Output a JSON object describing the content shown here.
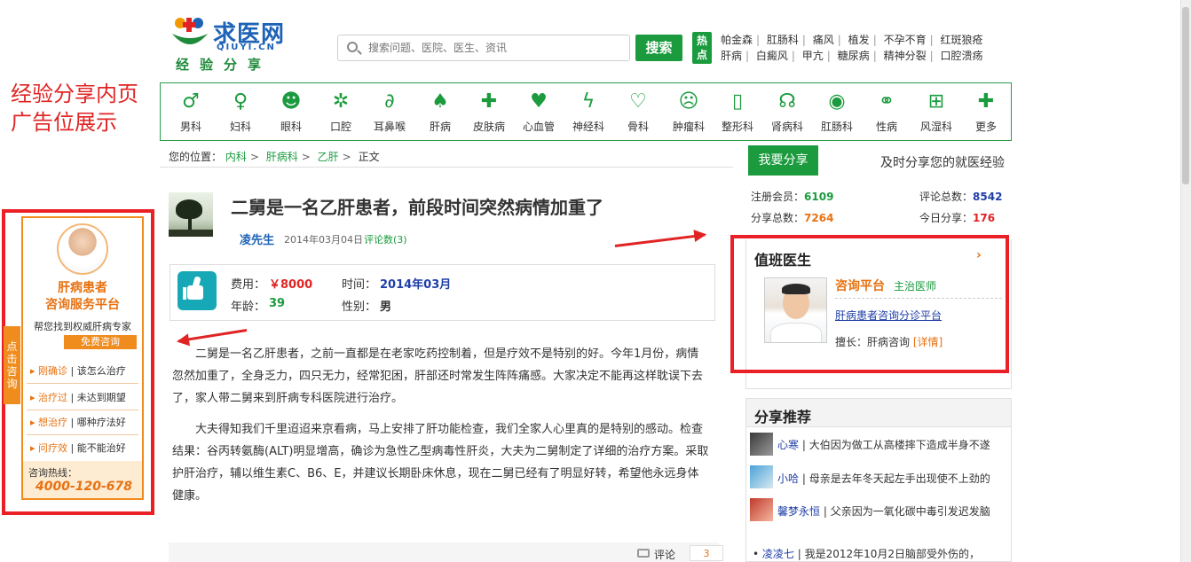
{
  "logo": {
    "name": "求医网",
    "en": "QIUYI.CN",
    "sub": "经验分享"
  },
  "search": {
    "placeholder": "搜索问题、医院、医生、资讯",
    "button": "搜索"
  },
  "hot": {
    "tag": "热点",
    "row1": [
      "帕金森",
      "肛肠科",
      "痛风",
      "植发",
      "不孕不育",
      "红斑狼疮"
    ],
    "row2": [
      "肝病",
      "白癜风",
      "甲亢",
      "糖尿病",
      "精神分裂",
      "口腔溃疡"
    ]
  },
  "annotation": {
    "line1": "经验分享内页",
    "line2": "广告位展示"
  },
  "nav": [
    {
      "label": "男科",
      "icon": "male-icon"
    },
    {
      "label": "妇科",
      "icon": "female-icon"
    },
    {
      "label": "眼科",
      "icon": "eye-head-icon"
    },
    {
      "label": "口腔",
      "icon": "tooth-icon"
    },
    {
      "label": "耳鼻喉",
      "icon": "ear-icon"
    },
    {
      "label": "肝病",
      "icon": "liver-icon"
    },
    {
      "label": "皮肤病",
      "icon": "ambulance-icon"
    },
    {
      "label": "心血管",
      "icon": "heart-organ-icon"
    },
    {
      "label": "神经科",
      "icon": "nerve-icon"
    },
    {
      "label": "骨科",
      "icon": "bone-icon"
    },
    {
      "label": "肿瘤科",
      "icon": "tumor-icon"
    },
    {
      "label": "整形科",
      "icon": "bottle-icon"
    },
    {
      "label": "肾病科",
      "icon": "stethoscope-icon"
    },
    {
      "label": "肛肠科",
      "icon": "eye-icon"
    },
    {
      "label": "性病",
      "icon": "couple-icon"
    },
    {
      "label": "风湿科",
      "icon": "first-aid-icon"
    },
    {
      "label": "更多",
      "icon": "plus-icon"
    }
  ],
  "breadcrumb": {
    "prefix": "您的位置：",
    "l1": "内科",
    "l2": "肝病科",
    "l3": "乙肝",
    "current": "正文"
  },
  "article": {
    "title": "二舅是一名乙肝患者，前段时间突然病情加重了",
    "author": "凌先生",
    "date": "2014年03月04日",
    "comments": "评论数(3)",
    "fee_label": "费用：",
    "fee_value": "￥8000",
    "time_label": "时间：",
    "time_value": "2014年03月",
    "age_label": "年龄：",
    "age_value": "39",
    "gender_label": "性别：",
    "gender_value": "男",
    "p1": "二舅是一名乙肝患者，之前一直都是在老家吃药控制着，但是疗效不是特别的好。今年1月份，病情忽然加重了，全身乏力，四只无力，经常犯困，肝部还时常发生阵阵痛感。大家决定不能再这样耽误下去了，家人带二舅来到肝病专科医院进行治疗。",
    "p2": "大夫得知我们千里迢迢来京看病，马上安排了肝功能检查，我们全家人心里真的是特别的感动。检查结果：谷丙转氨酶(ALT)明显增高，确诊为急性乙型病毒性肝炎，大夫为二舅制定了详细的治疗方案。采取护肝治疗，辅以维生素C、B6、E，并建议长期卧床休息，现在二舅已经有了明显好转，希望他永远身体健康。"
  },
  "bottom": {
    "comment_label": "评论",
    "comment_count": "3"
  },
  "ad": {
    "title1": "肝病患者",
    "title2": "咨询服务平台",
    "sub": "帮您找到权威肝病专家",
    "free": "免费咨询",
    "side": "点击咨询",
    "q": [
      {
        "k": "刚确诊",
        "v": "该怎么治疗"
      },
      {
        "k": "治疗过",
        "v": "未达到期望"
      },
      {
        "k": "想治疗",
        "v": "哪种疗法好"
      },
      {
        "k": "问疗效",
        "v": "能不能治好"
      }
    ],
    "hotline_label": "咨询热线：",
    "phone": "4000-120-678"
  },
  "sidebar": {
    "share_button": "我要分享",
    "share_tag": "及时分享您的就医经验",
    "members_label": "注册会员：",
    "members": "6109",
    "comments_label": "评论总数：",
    "comments": "8542",
    "shares_label": "分享总数：",
    "shares": "7264",
    "today_label": "今日分享：",
    "today": "176",
    "duty_title": "值班医生",
    "duty_more": "›",
    "duty_name": "咨询平台",
    "duty_role": "主治医师",
    "duty_link": "肝病患者咨询分诊平台",
    "duty_spec_label": "擅长：肝病咨询",
    "duty_detail": "[详情]",
    "rec_title": "分享推荐",
    "rec": [
      {
        "name": "心寒",
        "text": "大伯因为做工从高楼摔下造成半身不遂"
      },
      {
        "name": "小哈",
        "text": "母亲是去年冬天起左手出现使不上劲的"
      },
      {
        "name": "馨梦永恒",
        "text": "父亲因为一氧化碳中毒引发迟发脑"
      },
      {
        "name": "凌凌七",
        "text": "我是2012年10月2日脑部受外伤的，"
      }
    ]
  }
}
